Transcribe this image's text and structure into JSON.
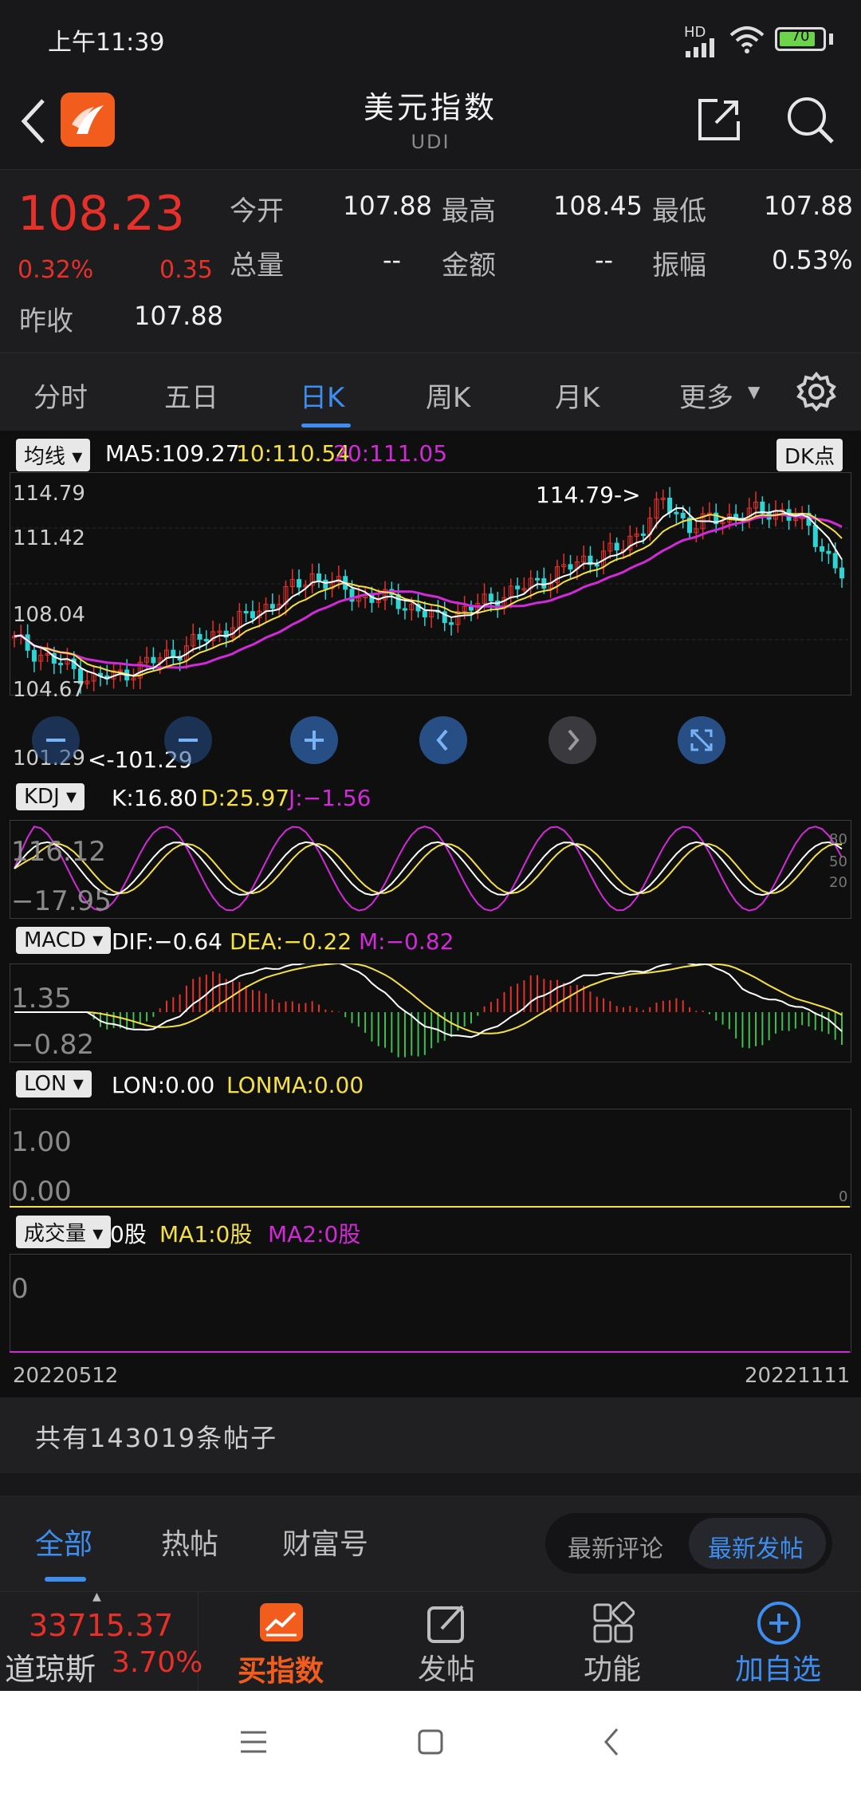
{
  "status_bar": {
    "time": "上午11:39",
    "battery": "70",
    "network": "HD"
  },
  "header": {
    "title": "美元指数",
    "subtitle": "UDI"
  },
  "quote": {
    "price": "108.23",
    "change_pct": "0.32%",
    "change": "0.35",
    "prev_close_label": "昨收",
    "prev_close": "107.88",
    "stats": [
      {
        "label": "今开",
        "value": "107.88",
        "red": false
      },
      {
        "label": "最高",
        "value": "108.45",
        "red": true
      },
      {
        "label": "最低",
        "value": "107.88",
        "red": false
      },
      {
        "label": "总量",
        "value": "--",
        "red": false
      },
      {
        "label": "金额",
        "value": "--",
        "red": false
      },
      {
        "label": "振幅",
        "value": "0.53%",
        "red": false
      }
    ]
  },
  "tabs": [
    "分时",
    "五日",
    "日K",
    "周K",
    "月K",
    "更多"
  ],
  "active_tab": "日K",
  "indicators": {
    "ma": {
      "button": "均线",
      "ma5": "MA5:109.27",
      "ma10": "10:110.54",
      "ma20": "20:111.05",
      "dk": "DK点"
    },
    "kdj": {
      "button": "KDJ",
      "k": "K:16.80",
      "d": "D:25.97",
      "j": "J:−1.56"
    },
    "macd": {
      "button": "MACD",
      "dif": "DIF:−0.64",
      "dea": "DEA:−0.22",
      "m": "M:−0.82"
    },
    "lon": {
      "button": "LON",
      "lon": "LON:0.00",
      "lonma": "LONMA:0.00"
    },
    "vol": {
      "button": "成交量",
      "vol": "0股",
      "ma1": "MA1:0股",
      "ma2": "MA2:0股"
    }
  },
  "axis_labels": {
    "price": [
      "114.79",
      "111.42",
      "108.04",
      "104.67",
      "101.29"
    ],
    "max_marker": "114.79->",
    "min_marker": "<-101.29",
    "kdj": [
      "116.12",
      "−17.95"
    ],
    "kdj_right": [
      "80",
      "50",
      "20"
    ],
    "macd": [
      "1.35",
      "−0.82"
    ],
    "lon": [
      "1.00",
      "0.00"
    ],
    "lon_right": "0",
    "vol": "0",
    "date_start": "20220512",
    "date_end": "20221111"
  },
  "posts_count": "共有143019条帖子",
  "feed_tabs": [
    "全部",
    "热帖",
    "财富号"
  ],
  "sort_toggle": [
    "最新评论",
    "最新发帖"
  ],
  "ticker": {
    "value": "33715.37",
    "name": "道琼斯",
    "pct": "3.70%"
  },
  "bottom_nav": [
    "买指数",
    "发帖",
    "功能",
    "加自选"
  ],
  "colors": {
    "up": "#e8302a",
    "down": "#2ed3d3",
    "accent": "#3d8ef0",
    "ma5": "#ffffff",
    "ma10": "#f5e046",
    "ma20": "#d22ad8"
  }
}
